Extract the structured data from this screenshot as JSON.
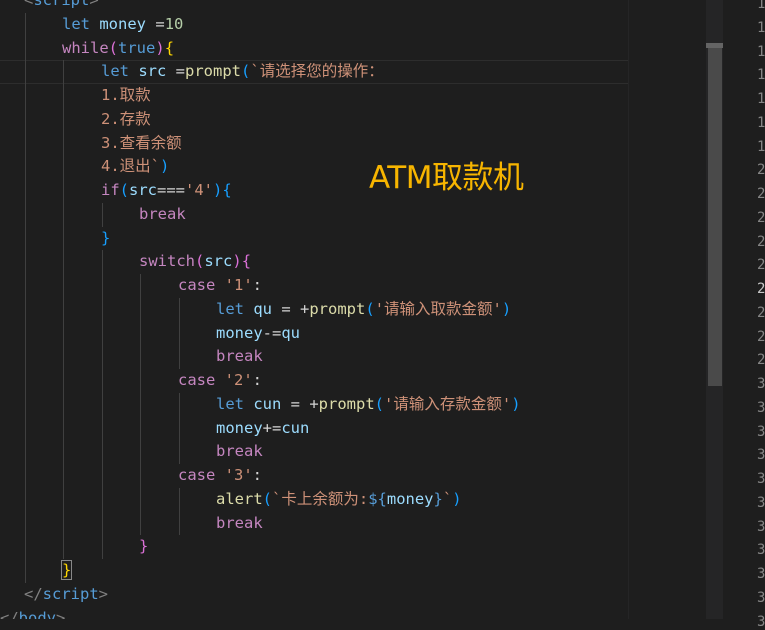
{
  "code_lines": [
    {
      "indent": 1,
      "tokens": [
        {
          "t": "<",
          "c": "punc"
        },
        {
          "t": "script",
          "c": "tag"
        },
        {
          "t": ">",
          "c": "punc"
        }
      ]
    },
    {
      "indent": 2,
      "tokens": [
        {
          "t": "let",
          "c": "kw"
        },
        {
          "t": " "
        },
        {
          "t": "money",
          "c": "var"
        },
        {
          "t": " ="
        },
        {
          "t": "10",
          "c": "num"
        }
      ]
    },
    {
      "indent": 2,
      "tokens": [
        {
          "t": "while",
          "c": "ctrl"
        },
        {
          "t": "(",
          "c": "paren"
        },
        {
          "t": "true",
          "c": "kw"
        },
        {
          "t": ")",
          "c": "paren"
        },
        {
          "t": "{",
          "c": "brace-y"
        }
      ]
    },
    {
      "indent": 3,
      "tokens": [
        {
          "t": "let",
          "c": "kw"
        },
        {
          "t": " "
        },
        {
          "t": "src",
          "c": "var"
        },
        {
          "t": " ="
        },
        {
          "t": "prompt",
          "c": "fn"
        },
        {
          "t": "(",
          "c": "brace-b"
        },
        {
          "t": "`请选择您的操作：",
          "c": "str"
        }
      ]
    },
    {
      "indent": 3,
      "tokens": [
        {
          "t": "1.取款",
          "c": "str"
        }
      ]
    },
    {
      "indent": 3,
      "tokens": [
        {
          "t": "2.存款",
          "c": "str"
        }
      ]
    },
    {
      "indent": 3,
      "tokens": [
        {
          "t": "3.查看余额",
          "c": "str"
        }
      ]
    },
    {
      "indent": 3,
      "tokens": [
        {
          "t": "4.退出`",
          "c": "str"
        },
        {
          "t": ")",
          "c": "brace-b"
        }
      ]
    },
    {
      "indent": 3,
      "tokens": [
        {
          "t": "if",
          "c": "ctrl"
        },
        {
          "t": "(",
          "c": "brace-b"
        },
        {
          "t": "src",
          "c": "var"
        },
        {
          "t": "==="
        },
        {
          "t": "'4'",
          "c": "str"
        },
        {
          "t": ")",
          "c": "brace-b"
        },
        {
          "t": "{",
          "c": "brace-b"
        }
      ]
    },
    {
      "indent": 4,
      "tokens": [
        {
          "t": "break",
          "c": "ctrl"
        }
      ]
    },
    {
      "indent": 3,
      "tokens": [
        {
          "t": "}",
          "c": "brace-b"
        }
      ]
    },
    {
      "indent": 4,
      "tokens": [
        {
          "t": "switch",
          "c": "ctrl"
        },
        {
          "t": "(",
          "c": "paren"
        },
        {
          "t": "src",
          "c": "var"
        },
        {
          "t": ")",
          "c": "paren"
        },
        {
          "t": "{",
          "c": "paren"
        }
      ]
    },
    {
      "indent": 5,
      "tokens": [
        {
          "t": "case",
          "c": "ctrl"
        },
        {
          "t": " "
        },
        {
          "t": "'1'",
          "c": "str"
        },
        {
          "t": ":"
        }
      ]
    },
    {
      "indent": 6,
      "tokens": [
        {
          "t": "let",
          "c": "kw"
        },
        {
          "t": " "
        },
        {
          "t": "qu",
          "c": "var"
        },
        {
          "t": " = +"
        },
        {
          "t": "prompt",
          "c": "fn"
        },
        {
          "t": "(",
          "c": "brace-b"
        },
        {
          "t": "'请输入取款金额'",
          "c": "str"
        },
        {
          "t": ")",
          "c": "brace-b"
        }
      ]
    },
    {
      "indent": 6,
      "tokens": [
        {
          "t": "money",
          "c": "var"
        },
        {
          "t": "-="
        },
        {
          "t": "qu",
          "c": "var"
        }
      ]
    },
    {
      "indent": 6,
      "tokens": [
        {
          "t": "break",
          "c": "ctrl"
        }
      ]
    },
    {
      "indent": 5,
      "tokens": [
        {
          "t": "case",
          "c": "ctrl"
        },
        {
          "t": " "
        },
        {
          "t": "'2'",
          "c": "str"
        },
        {
          "t": ":"
        }
      ]
    },
    {
      "indent": 6,
      "tokens": [
        {
          "t": "let",
          "c": "kw"
        },
        {
          "t": " "
        },
        {
          "t": "cun",
          "c": "var"
        },
        {
          "t": " = +"
        },
        {
          "t": "prompt",
          "c": "fn"
        },
        {
          "t": "(",
          "c": "brace-b"
        },
        {
          "t": "'请输入存款金额'",
          "c": "str"
        },
        {
          "t": ")",
          "c": "brace-b"
        }
      ]
    },
    {
      "indent": 6,
      "tokens": [
        {
          "t": "money",
          "c": "var"
        },
        {
          "t": "+="
        },
        {
          "t": "cun",
          "c": "var"
        }
      ]
    },
    {
      "indent": 6,
      "tokens": [
        {
          "t": "break",
          "c": "ctrl"
        }
      ]
    },
    {
      "indent": 5,
      "tokens": [
        {
          "t": "case",
          "c": "ctrl"
        },
        {
          "t": " "
        },
        {
          "t": "'3'",
          "c": "str"
        },
        {
          "t": ":"
        }
      ]
    },
    {
      "indent": 6,
      "tokens": [
        {
          "t": "alert",
          "c": "fn"
        },
        {
          "t": "(",
          "c": "brace-b"
        },
        {
          "t": "`卡上余额为:",
          "c": "str"
        },
        {
          "t": "${",
          "c": "kw"
        },
        {
          "t": "money",
          "c": "var"
        },
        {
          "t": "}",
          "c": "kw"
        },
        {
          "t": "`",
          "c": "str"
        },
        {
          "t": ")",
          "c": "brace-b"
        }
      ]
    },
    {
      "indent": 6,
      "tokens": [
        {
          "t": "break",
          "c": "ctrl"
        }
      ]
    },
    {
      "indent": 4,
      "tokens": [
        {
          "t": "}",
          "c": "paren"
        }
      ]
    },
    {
      "indent": 2,
      "tokens": [
        {
          "t": "}",
          "c": "brace-y bm"
        }
      ]
    },
    {
      "indent": 1,
      "tokens": [
        {
          "t": "</",
          "c": "punc"
        },
        {
          "t": "script",
          "c": "tag"
        },
        {
          "t": ">",
          "c": "punc"
        }
      ]
    },
    {
      "indent": 0,
      "tokens": [
        {
          "t": "</",
          "c": "punc"
        },
        {
          "t": "body",
          "c": "tag"
        },
        {
          "t": ">",
          "c": "punc"
        }
      ]
    }
  ],
  "annotation": "ATM取款机",
  "line_numbers": [
    {
      "n": "1"
    },
    {
      "n": "1"
    },
    {
      "n": "1"
    },
    {
      "n": "1"
    },
    {
      "n": "1"
    },
    {
      "n": "1"
    },
    {
      "n": "1"
    },
    {
      "n": "2"
    },
    {
      "n": "2"
    },
    {
      "n": "2"
    },
    {
      "n": "2"
    },
    {
      "n": "2"
    },
    {
      "n": "2",
      "active": true
    },
    {
      "n": "2"
    },
    {
      "n": "2"
    },
    {
      "n": "2"
    },
    {
      "n": "3"
    },
    {
      "n": "3"
    },
    {
      "n": "3"
    },
    {
      "n": "3"
    },
    {
      "n": "3"
    },
    {
      "n": "3"
    },
    {
      "n": "3"
    },
    {
      "n": "3"
    },
    {
      "n": "3"
    },
    {
      "n": "3"
    },
    {
      "n": "3"
    }
  ]
}
